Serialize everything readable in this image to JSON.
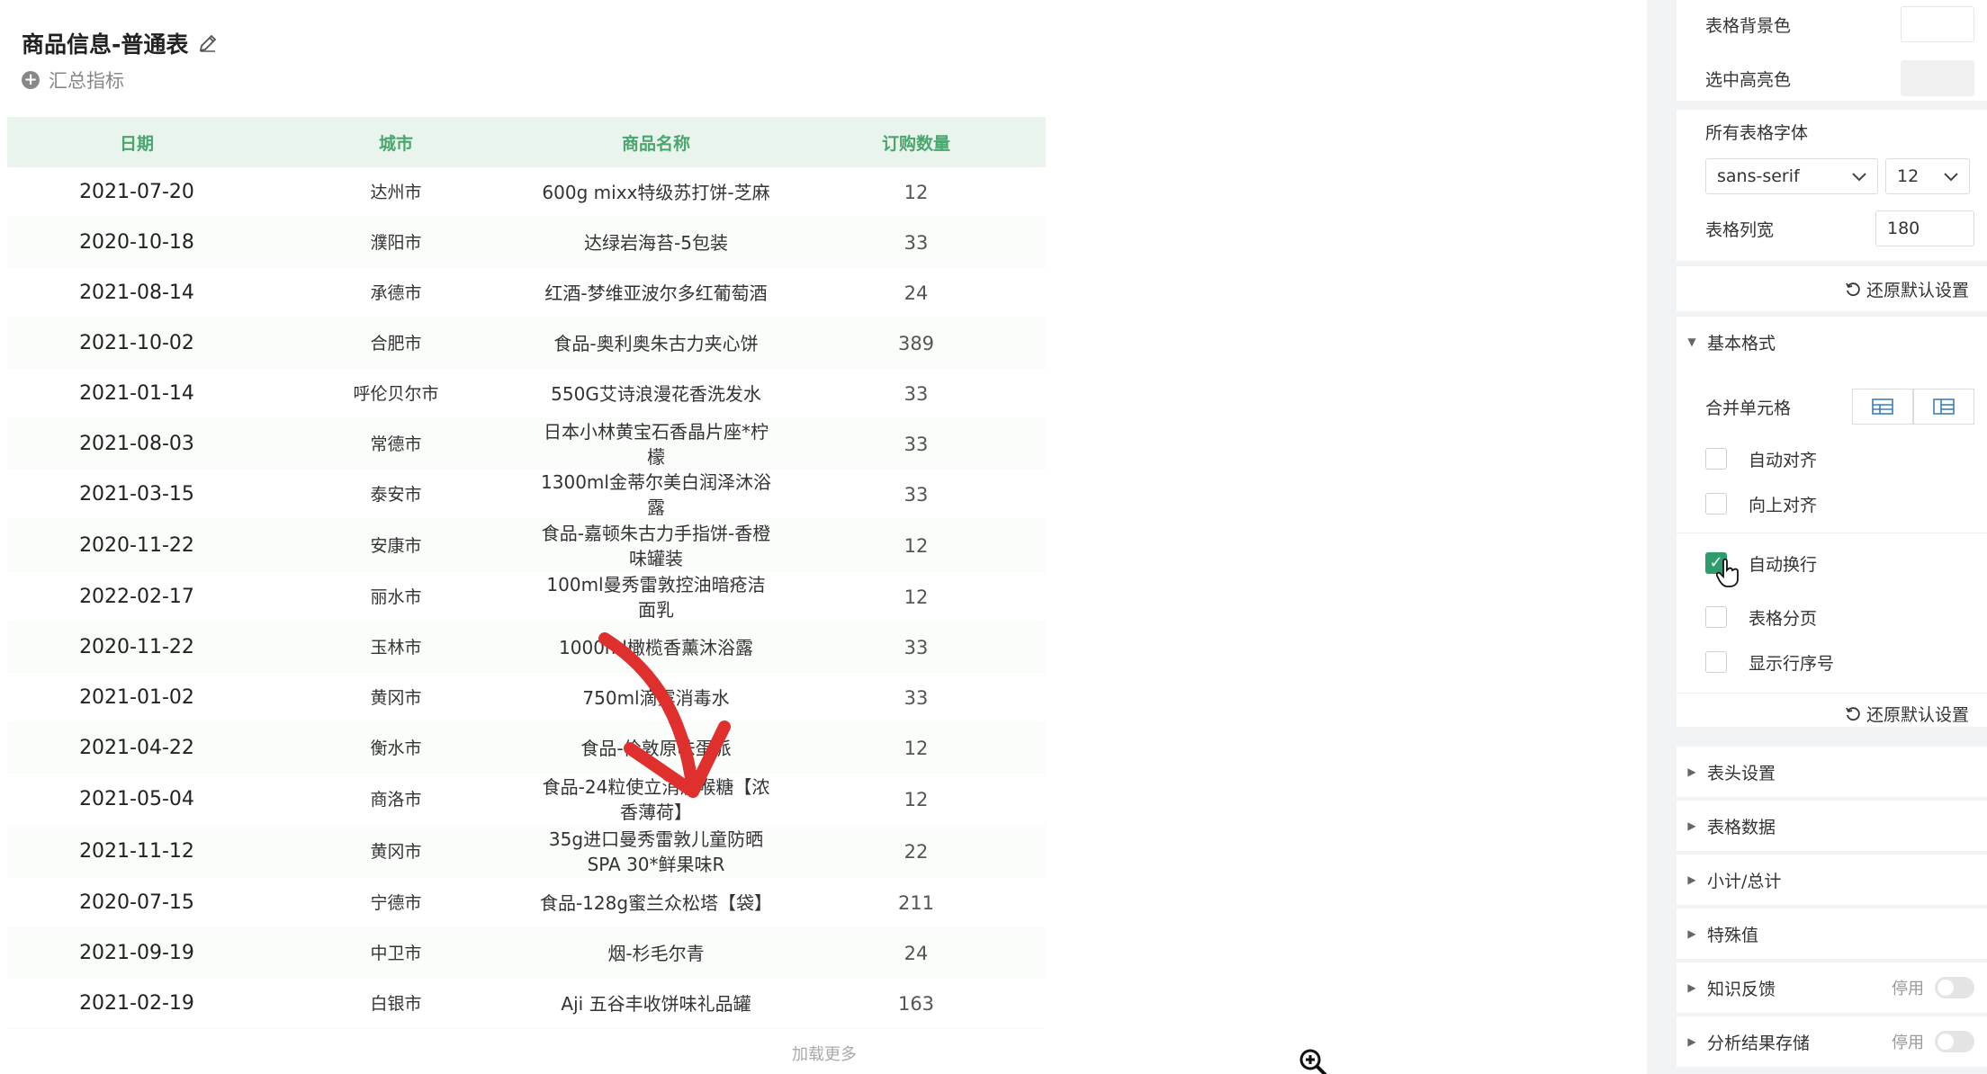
{
  "header": {
    "title": "商品信息-普通表",
    "summary_label": "汇总指标"
  },
  "table": {
    "columns": [
      "日期",
      "城市",
      "商品名称",
      "订购数量"
    ],
    "rows": [
      [
        "2021-07-20",
        "达州市",
        "600g mixx特级苏打饼-芝麻",
        "12"
      ],
      [
        "2020-10-18",
        "濮阳市",
        "达绿岩海苔-5包装",
        "33"
      ],
      [
        "2021-08-14",
        "承德市",
        "红酒-梦维亚波尔多红葡萄酒",
        "24"
      ],
      [
        "2021-10-02",
        "合肥市",
        "食品-奥利奥朱古力夹心饼",
        "389"
      ],
      [
        "2021-01-14",
        "呼伦贝尔市",
        "550G艾诗浪漫花香洗发水",
        "33"
      ],
      [
        "2021-08-03",
        "常德市",
        "日本小林黄宝石香晶片座*柠檬",
        "33"
      ],
      [
        "2021-03-15",
        "泰安市",
        "1300ml金蒂尔美白润泽沐浴露",
        "33"
      ],
      [
        "2020-11-22",
        "安康市",
        "食品-嘉顿朱古力手指饼-香橙味罐装",
        "12"
      ],
      [
        "2022-02-17",
        "丽水市",
        "100ml曼秀雷敦控油暗疮洁面乳",
        "12"
      ],
      [
        "2020-11-22",
        "玉林市",
        "1000ml橄榄香薰沐浴露",
        "33"
      ],
      [
        "2021-01-02",
        "黄冈市",
        "750ml滴露消毒水",
        "33"
      ],
      [
        "2021-04-22",
        "衡水市",
        "食品-伦敦原味蛋派",
        "12"
      ],
      [
        "2021-05-04",
        "商洛市",
        "食品-24粒使立消润喉糖【浓香薄荷】",
        "12"
      ],
      [
        "2021-11-12",
        "黄冈市",
        "35g进口曼秀雷敦儿童防晒SPA 30*鲜果味R",
        "22"
      ],
      [
        "2020-07-15",
        "宁德市",
        "食品-128g蜜兰众松塔【袋】",
        "211"
      ],
      [
        "2021-09-19",
        "中卫市",
        "烟-杉毛尔青",
        "24"
      ],
      [
        "2021-02-19",
        "白银市",
        "Aji 五谷丰收饼味礼品罐",
        "163"
      ]
    ],
    "load_more": "加载更多"
  },
  "panel": {
    "table_bg_label": "表格背景色",
    "highlight_label": "选中高亮色",
    "font_label": "所有表格字体",
    "font_value": "sans-serif",
    "font_size_value": "12",
    "col_width_label": "表格列宽",
    "col_width_value": "180",
    "reset_label": "还原默认设置",
    "basic_format": "基本格式",
    "merge_cells": "合并单元格",
    "auto_align": "自动对齐",
    "top_align": "向上对齐",
    "auto_wrap": "自动换行",
    "pagination": "表格分页",
    "show_row_num": "显示行序号",
    "reset_label_2": "还原默认设置",
    "sections": [
      "表头设置",
      "表格数据",
      "小计/总计",
      "特殊值"
    ],
    "knowledge_feedback": "知识反馈",
    "result_storage": "分析结果存储",
    "disabled_text": "停用"
  }
}
